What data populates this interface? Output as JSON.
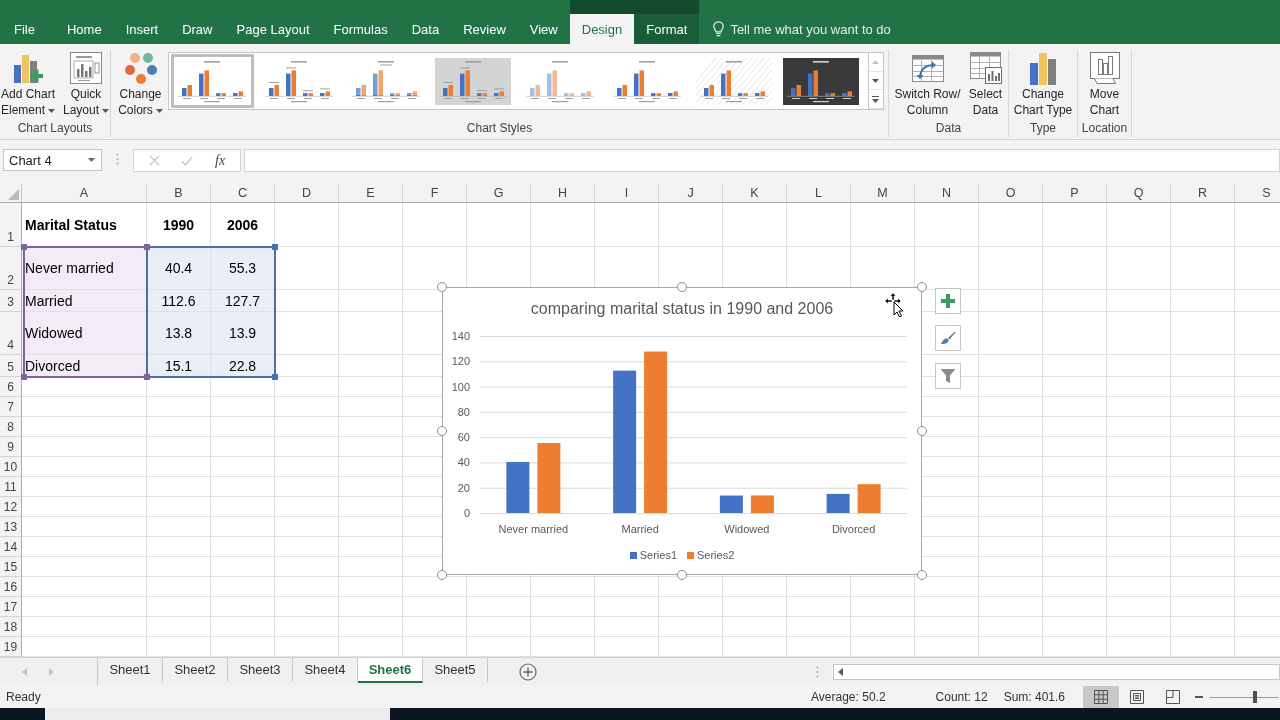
{
  "ribbon": {
    "tabs": [
      {
        "label": "File",
        "selected": false,
        "contextual": false
      },
      {
        "label": "Home",
        "selected": false,
        "contextual": false
      },
      {
        "label": "Insert",
        "selected": false,
        "contextual": false
      },
      {
        "label": "Draw",
        "selected": false,
        "contextual": false
      },
      {
        "label": "Page Layout",
        "selected": false,
        "contextual": false
      },
      {
        "label": "Formulas",
        "selected": false,
        "contextual": false
      },
      {
        "label": "Data",
        "selected": false,
        "contextual": false
      },
      {
        "label": "Review",
        "selected": false,
        "contextual": false
      },
      {
        "label": "View",
        "selected": false,
        "contextual": false
      },
      {
        "label": "Design",
        "selected": true,
        "contextual": true
      },
      {
        "label": "Format",
        "selected": false,
        "contextual": true
      }
    ],
    "tell_me": "Tell me what you want to do",
    "groups": [
      {
        "label": "Chart Layouts",
        "items": [
          {
            "kind": "button",
            "lines": [
              "Add Chart",
              "Element"
            ],
            "dropdown": true
          },
          {
            "kind": "button",
            "lines": [
              "Quick",
              "Layout"
            ],
            "dropdown": true
          }
        ]
      },
      {
        "label": "Chart Styles",
        "items": [
          {
            "kind": "button",
            "lines": [
              "Change",
              "Colors"
            ],
            "dropdown": true
          },
          {
            "kind": "gallery",
            "styles": [
              {
                "selected": true
              },
              {
                "selected": false
              },
              {
                "selected": false
              },
              {
                "selected": false
              },
              {
                "selected": false
              },
              {
                "selected": false
              },
              {
                "selected": false
              },
              {
                "selected": false
              }
            ]
          }
        ]
      },
      {
        "label": "Data",
        "items": [
          {
            "kind": "button",
            "lines": [
              "Switch Row/",
              "Column"
            ],
            "dropdown": false
          },
          {
            "kind": "button",
            "lines": [
              "Select",
              "Data"
            ],
            "dropdown": false
          }
        ]
      },
      {
        "label": "Type",
        "items": [
          {
            "kind": "button",
            "lines": [
              "Change",
              "Chart Type"
            ],
            "dropdown": false
          }
        ]
      },
      {
        "label": "Location",
        "items": [
          {
            "kind": "button",
            "lines": [
              "Move",
              "Chart"
            ],
            "dropdown": false
          }
        ]
      }
    ]
  },
  "formula_bar": {
    "name_box": "Chart 4",
    "function_label": "fx"
  },
  "sheet": {
    "columns": [
      "A",
      "B",
      "C",
      "D",
      "E",
      "F",
      "G",
      "H",
      "I",
      "J",
      "K",
      "L",
      "M",
      "N",
      "O",
      "P",
      "Q",
      "R",
      "S"
    ],
    "rows": [
      {
        "number": "1",
        "cells": [
          {
            "text": "Marital Status",
            "bold": true
          },
          {
            "text": "1990",
            "bold": true
          },
          {
            "text": "2006",
            "bold": true
          }
        ]
      },
      {
        "number": "2",
        "cells": [
          {
            "text": "Never married",
            "bold": false
          },
          {
            "text": "40.4",
            "bold": false
          },
          {
            "text": "55.3",
            "bold": false
          }
        ]
      },
      {
        "number": "3",
        "cells": [
          {
            "text": "Married",
            "bold": false
          },
          {
            "text": "112.6",
            "bold": false
          },
          {
            "text": "127.7",
            "bold": false
          }
        ]
      },
      {
        "number": "4",
        "cells": [
          {
            "text": "Widowed",
            "bold": false
          },
          {
            "text": "13.8",
            "bold": false
          },
          {
            "text": "13.9",
            "bold": false
          }
        ]
      },
      {
        "number": "5",
        "cells": [
          {
            "text": "Divorced",
            "bold": false
          },
          {
            "text": "15.1",
            "bold": false
          },
          {
            "text": "22.8",
            "bold": false
          }
        ]
      },
      {
        "number": "6"
      },
      {
        "number": "7"
      },
      {
        "number": "8"
      },
      {
        "number": "9"
      },
      {
        "number": "10"
      },
      {
        "number": "11"
      },
      {
        "number": "12"
      },
      {
        "number": "13"
      },
      {
        "number": "14"
      },
      {
        "number": "15"
      },
      {
        "number": "16"
      },
      {
        "number": "17"
      },
      {
        "number": "18"
      },
      {
        "number": "19"
      }
    ]
  },
  "chart": {
    "selected": true,
    "chart_data": {
      "type": "bar",
      "title": "comparing marital status in 1990 and 2006",
      "categories": [
        "Never married",
        "Married",
        "Widowed",
        "Divorced"
      ],
      "series": [
        {
          "name": "Series1",
          "color": "#4472c4",
          "values": [
            40.4,
            112.6,
            13.8,
            15.1
          ]
        },
        {
          "name": "Series2",
          "color": "#ed7d31",
          "values": [
            55.3,
            127.7,
            13.9,
            22.8
          ]
        }
      ],
      "ylim": [
        0,
        140
      ],
      "yticks": [
        0,
        20,
        40,
        60,
        80,
        100,
        120,
        140
      ],
      "grid": true,
      "legend": "bottom"
    }
  },
  "sheet_tabs": [
    {
      "label": "Sheet1",
      "selected": false
    },
    {
      "label": "Sheet2",
      "selected": false
    },
    {
      "label": "Sheet3",
      "selected": false
    },
    {
      "label": "Sheet4",
      "selected": false
    },
    {
      "label": "Sheet6",
      "selected": true
    },
    {
      "label": "Sheet5",
      "selected": false
    }
  ],
  "status_bar": {
    "mode": "Ready",
    "stats": [
      "Average: 50.2",
      "Count: 12",
      "Sum: 401.6"
    ],
    "views": [
      {
        "selected": true
      },
      {
        "selected": false
      },
      {
        "selected": false
      }
    ],
    "zoom": {
      "level": 0.66
    }
  }
}
